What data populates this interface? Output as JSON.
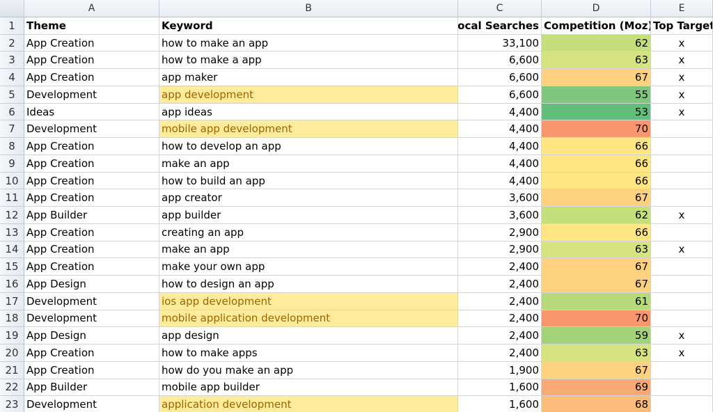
{
  "column_headers": [
    "A",
    "B",
    "C",
    "D",
    "E"
  ],
  "header_row": {
    "row_number": "1",
    "theme": "Theme",
    "keyword": "Keyword",
    "local_searches": "Local Searches",
    "competition": "Competition (Moz)",
    "top_target": "Top Target"
  },
  "rows": [
    {
      "n": "2",
      "theme": "App Creation",
      "keyword": "how to make an app",
      "searches": "33,100",
      "competition": "62",
      "color": "#c5df7c",
      "top": "x",
      "highlight": false
    },
    {
      "n": "3",
      "theme": "App Creation",
      "keyword": "how to make a app",
      "searches": "6,600",
      "competition": "63",
      "color": "#d6e381",
      "top": "x",
      "highlight": false
    },
    {
      "n": "4",
      "theme": "App Creation",
      "keyword": "app maker",
      "searches": "6,600",
      "competition": "67",
      "color": "#fdd17f",
      "top": "x",
      "highlight": false
    },
    {
      "n": "5",
      "theme": "Development",
      "keyword": "app development",
      "searches": "6,600",
      "competition": "55",
      "color": "#7fc77c",
      "top": "x",
      "highlight": true
    },
    {
      "n": "6",
      "theme": "Ideas",
      "keyword": "app ideas",
      "searches": "4,400",
      "competition": "53",
      "color": "#63be7b",
      "top": "x",
      "highlight": false
    },
    {
      "n": "7",
      "theme": "Development",
      "keyword": "mobile app development",
      "searches": "4,400",
      "competition": "70",
      "color": "#f8966d",
      "top": "",
      "highlight": true
    },
    {
      "n": "8",
      "theme": "App Creation",
      "keyword": "how to develop an app",
      "searches": "4,400",
      "competition": "66",
      "color": "#ffe683",
      "top": "",
      "highlight": false
    },
    {
      "n": "9",
      "theme": "App Creation",
      "keyword": "make an app",
      "searches": "4,400",
      "competition": "66",
      "color": "#ffe683",
      "top": "",
      "highlight": false
    },
    {
      "n": "10",
      "theme": "App Creation",
      "keyword": "how to build an app",
      "searches": "4,400",
      "competition": "66",
      "color": "#ffe683",
      "top": "",
      "highlight": false
    },
    {
      "n": "11",
      "theme": "App Creation",
      "keyword": "app creator",
      "searches": "3,600",
      "competition": "67",
      "color": "#fdd17f",
      "top": "",
      "highlight": false
    },
    {
      "n": "12",
      "theme": "App Builder",
      "keyword": "app builder",
      "searches": "3,600",
      "competition": "62",
      "color": "#c5df7c",
      "top": "x",
      "highlight": false
    },
    {
      "n": "13",
      "theme": "App Creation",
      "keyword": "creating an app",
      "searches": "2,900",
      "competition": "66",
      "color": "#ffe683",
      "top": "",
      "highlight": false
    },
    {
      "n": "14",
      "theme": "App Creation",
      "keyword": "make an app",
      "searches": "2,900",
      "competition": "63",
      "color": "#d6e381",
      "top": "x",
      "highlight": false
    },
    {
      "n": "15",
      "theme": "App Creation",
      "keyword": "make your own app",
      "searches": "2,400",
      "competition": "67",
      "color": "#fdd17f",
      "top": "",
      "highlight": false
    },
    {
      "n": "16",
      "theme": "App Design",
      "keyword": "how to design an app",
      "searches": "2,400",
      "competition": "67",
      "color": "#fdd17f",
      "top": "",
      "highlight": false
    },
    {
      "n": "17",
      "theme": "Development",
      "keyword": "ios app development",
      "searches": "2,400",
      "competition": "61",
      "color": "#b6d97a",
      "top": "",
      "highlight": true
    },
    {
      "n": "18",
      "theme": "Development",
      "keyword": "mobile application development",
      "searches": "2,400",
      "competition": "70",
      "color": "#f8966d",
      "top": "",
      "highlight": true
    },
    {
      "n": "19",
      "theme": "App Design",
      "keyword": "app design",
      "searches": "2,400",
      "competition": "59",
      "color": "#a2d379",
      "top": "x",
      "highlight": false
    },
    {
      "n": "20",
      "theme": "App Creation",
      "keyword": "how to make apps",
      "searches": "2,400",
      "competition": "63",
      "color": "#d6e381",
      "top": "x",
      "highlight": false
    },
    {
      "n": "21",
      "theme": "App Creation",
      "keyword": "how do you make an app",
      "searches": "1,900",
      "competition": "67",
      "color": "#fdd17f",
      "top": "",
      "highlight": false
    },
    {
      "n": "22",
      "theme": "App Builder",
      "keyword": "mobile app builder",
      "searches": "1,600",
      "competition": "69",
      "color": "#faa874",
      "top": "",
      "highlight": false
    },
    {
      "n": "23",
      "theme": "Development",
      "keyword": "application development",
      "searches": "1,600",
      "competition": "68",
      "color": "#fcbc79",
      "top": "",
      "highlight": true
    }
  ]
}
